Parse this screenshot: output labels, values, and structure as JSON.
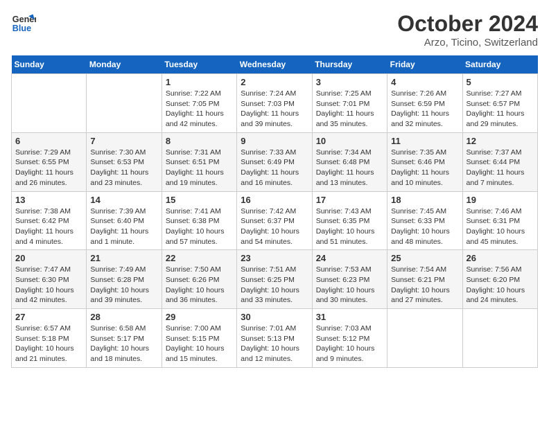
{
  "header": {
    "logo_line1": "General",
    "logo_line2": "Blue",
    "month": "October 2024",
    "location": "Arzo, Ticino, Switzerland"
  },
  "weekdays": [
    "Sunday",
    "Monday",
    "Tuesday",
    "Wednesday",
    "Thursday",
    "Friday",
    "Saturday"
  ],
  "weeks": [
    [
      {
        "day": "",
        "info": ""
      },
      {
        "day": "",
        "info": ""
      },
      {
        "day": "1",
        "info": "Sunrise: 7:22 AM\nSunset: 7:05 PM\nDaylight: 11 hours and 42 minutes."
      },
      {
        "day": "2",
        "info": "Sunrise: 7:24 AM\nSunset: 7:03 PM\nDaylight: 11 hours and 39 minutes."
      },
      {
        "day": "3",
        "info": "Sunrise: 7:25 AM\nSunset: 7:01 PM\nDaylight: 11 hours and 35 minutes."
      },
      {
        "day": "4",
        "info": "Sunrise: 7:26 AM\nSunset: 6:59 PM\nDaylight: 11 hours and 32 minutes."
      },
      {
        "day": "5",
        "info": "Sunrise: 7:27 AM\nSunset: 6:57 PM\nDaylight: 11 hours and 29 minutes."
      }
    ],
    [
      {
        "day": "6",
        "info": "Sunrise: 7:29 AM\nSunset: 6:55 PM\nDaylight: 11 hours and 26 minutes."
      },
      {
        "day": "7",
        "info": "Sunrise: 7:30 AM\nSunset: 6:53 PM\nDaylight: 11 hours and 23 minutes."
      },
      {
        "day": "8",
        "info": "Sunrise: 7:31 AM\nSunset: 6:51 PM\nDaylight: 11 hours and 19 minutes."
      },
      {
        "day": "9",
        "info": "Sunrise: 7:33 AM\nSunset: 6:49 PM\nDaylight: 11 hours and 16 minutes."
      },
      {
        "day": "10",
        "info": "Sunrise: 7:34 AM\nSunset: 6:48 PM\nDaylight: 11 hours and 13 minutes."
      },
      {
        "day": "11",
        "info": "Sunrise: 7:35 AM\nSunset: 6:46 PM\nDaylight: 11 hours and 10 minutes."
      },
      {
        "day": "12",
        "info": "Sunrise: 7:37 AM\nSunset: 6:44 PM\nDaylight: 11 hours and 7 minutes."
      }
    ],
    [
      {
        "day": "13",
        "info": "Sunrise: 7:38 AM\nSunset: 6:42 PM\nDaylight: 11 hours and 4 minutes."
      },
      {
        "day": "14",
        "info": "Sunrise: 7:39 AM\nSunset: 6:40 PM\nDaylight: 11 hours and 1 minute."
      },
      {
        "day": "15",
        "info": "Sunrise: 7:41 AM\nSunset: 6:38 PM\nDaylight: 10 hours and 57 minutes."
      },
      {
        "day": "16",
        "info": "Sunrise: 7:42 AM\nSunset: 6:37 PM\nDaylight: 10 hours and 54 minutes."
      },
      {
        "day": "17",
        "info": "Sunrise: 7:43 AM\nSunset: 6:35 PM\nDaylight: 10 hours and 51 minutes."
      },
      {
        "day": "18",
        "info": "Sunrise: 7:45 AM\nSunset: 6:33 PM\nDaylight: 10 hours and 48 minutes."
      },
      {
        "day": "19",
        "info": "Sunrise: 7:46 AM\nSunset: 6:31 PM\nDaylight: 10 hours and 45 minutes."
      }
    ],
    [
      {
        "day": "20",
        "info": "Sunrise: 7:47 AM\nSunset: 6:30 PM\nDaylight: 10 hours and 42 minutes."
      },
      {
        "day": "21",
        "info": "Sunrise: 7:49 AM\nSunset: 6:28 PM\nDaylight: 10 hours and 39 minutes."
      },
      {
        "day": "22",
        "info": "Sunrise: 7:50 AM\nSunset: 6:26 PM\nDaylight: 10 hours and 36 minutes."
      },
      {
        "day": "23",
        "info": "Sunrise: 7:51 AM\nSunset: 6:25 PM\nDaylight: 10 hours and 33 minutes."
      },
      {
        "day": "24",
        "info": "Sunrise: 7:53 AM\nSunset: 6:23 PM\nDaylight: 10 hours and 30 minutes."
      },
      {
        "day": "25",
        "info": "Sunrise: 7:54 AM\nSunset: 6:21 PM\nDaylight: 10 hours and 27 minutes."
      },
      {
        "day": "26",
        "info": "Sunrise: 7:56 AM\nSunset: 6:20 PM\nDaylight: 10 hours and 24 minutes."
      }
    ],
    [
      {
        "day": "27",
        "info": "Sunrise: 6:57 AM\nSunset: 5:18 PM\nDaylight: 10 hours and 21 minutes."
      },
      {
        "day": "28",
        "info": "Sunrise: 6:58 AM\nSunset: 5:17 PM\nDaylight: 10 hours and 18 minutes."
      },
      {
        "day": "29",
        "info": "Sunrise: 7:00 AM\nSunset: 5:15 PM\nDaylight: 10 hours and 15 minutes."
      },
      {
        "day": "30",
        "info": "Sunrise: 7:01 AM\nSunset: 5:13 PM\nDaylight: 10 hours and 12 minutes."
      },
      {
        "day": "31",
        "info": "Sunrise: 7:03 AM\nSunset: 5:12 PM\nDaylight: 10 hours and 9 minutes."
      },
      {
        "day": "",
        "info": ""
      },
      {
        "day": "",
        "info": ""
      }
    ]
  ]
}
